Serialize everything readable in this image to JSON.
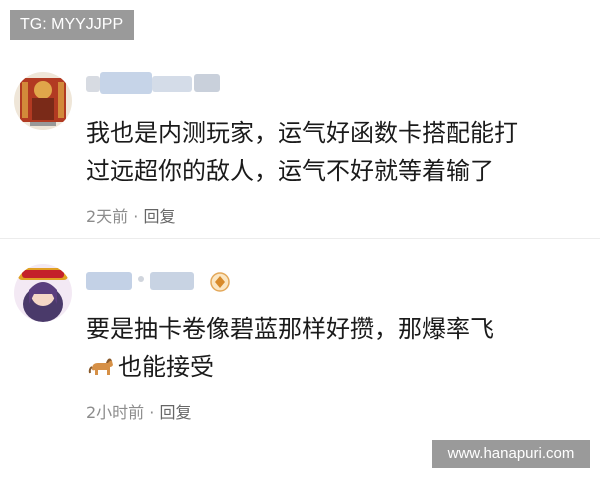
{
  "tg_badge": "TG: MYYJJPP",
  "watermark": "www.hanapuri.com",
  "comments": [
    {
      "text_line1": "我也是内测玩家，运气好函数卡搭配能打",
      "text_line2": "过远超你的敌人，运气不好就等着输了",
      "time": "2天前",
      "separator": " · ",
      "reply": "回复",
      "avatar_icon": "deity-avatar-icon"
    },
    {
      "text_line1": "要是抽卡卷像碧蓝那样好攒，那爆率飞",
      "text_line2": "也能接受",
      "emoji": "horse-emoji-icon",
      "time": "2小时前",
      "separator": " · ",
      "reply": "回复",
      "avatar_icon": "anime-girl-avatar-icon",
      "badge_icon": "level-badge-icon"
    }
  ],
  "colors": {
    "text": "#1a1a1a",
    "meta": "#8c8c8c",
    "badge_bg": "#9a9a9a",
    "blur": "#c9d6e6"
  }
}
